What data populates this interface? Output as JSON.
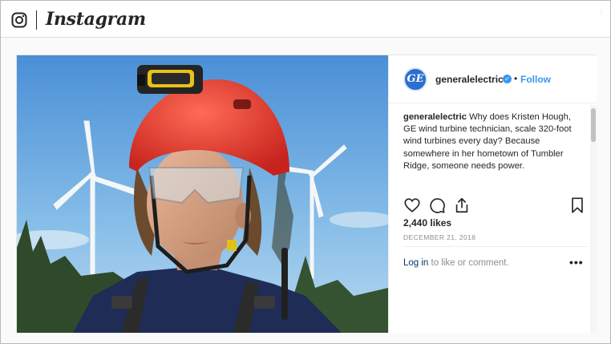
{
  "app": {
    "name": "Instagram"
  },
  "post": {
    "author": "generalelectric",
    "avatar_text": "GE",
    "verified_mark": "✓",
    "separator": "•",
    "follow_label": "Follow",
    "caption": "Why does Kristen Hough, GE wind turbine technician, scale 320-foot wind turbines every day? Because somewhere in her hometown of Tumbler Ridge, someone needs power.",
    "likes": "2,440 likes",
    "date": "DECEMBER 21, 2018",
    "login_link": "Log in",
    "login_rest": " to like or comment.",
    "more_label": "•••"
  },
  "colors": {
    "accent": "#3897f0",
    "link": "#003569",
    "muted": "#8e8e8e",
    "text": "#262626"
  },
  "icons": [
    "instagram-glyph-icon",
    "verified-badge-icon",
    "heart-icon",
    "comment-icon",
    "share-icon",
    "bookmark-icon",
    "more-options-icon"
  ]
}
